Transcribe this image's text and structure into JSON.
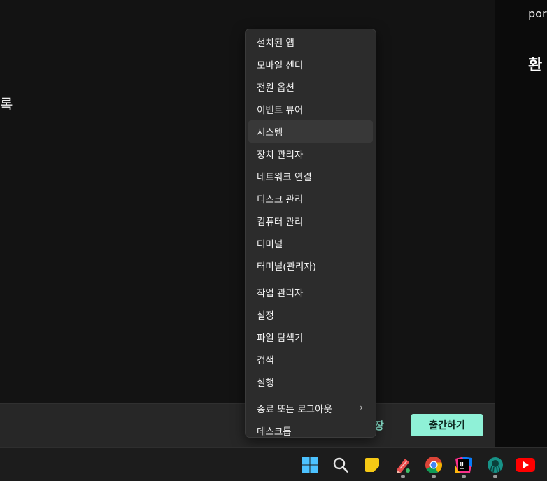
{
  "background": {
    "left_fragment": "록",
    "right_fragment_top": "por",
    "right_fragment_heading": "환"
  },
  "footer": {
    "secondary_action": "장",
    "primary_action": "출간하기",
    "accent_color": "#8ff1d7"
  },
  "context_menu": {
    "groups": [
      {
        "items": [
          {
            "label": "설치된 앱"
          },
          {
            "label": "모바일 센터"
          },
          {
            "label": "전원 옵션"
          },
          {
            "label": "이벤트 뷰어"
          },
          {
            "label": "시스템"
          },
          {
            "label": "장치 관리자"
          },
          {
            "label": "네트워크 연결"
          },
          {
            "label": "디스크 관리"
          },
          {
            "label": "컴퓨터 관리"
          },
          {
            "label": "터미널"
          },
          {
            "label": "터미널(관리자)"
          }
        ]
      },
      {
        "items": [
          {
            "label": "작업 관리자"
          },
          {
            "label": "설정"
          },
          {
            "label": "파일 탐색기"
          },
          {
            "label": "검색"
          },
          {
            "label": "실행"
          }
        ]
      },
      {
        "items": [
          {
            "label": "종료 또는 로그아웃",
            "submenu": "›"
          },
          {
            "label": "데스크톱"
          }
        ]
      }
    ],
    "hovered_item": "시스템"
  },
  "taskbar": {
    "icons": [
      "windows-start-icon",
      "search-icon",
      "sticky-notes-icon",
      "paint-app-icon",
      "chrome-icon",
      "jetbrains-ide-icon",
      "gitkraken-icon",
      "youtube-icon"
    ],
    "active_indicator_color": "#9a9a9a"
  }
}
